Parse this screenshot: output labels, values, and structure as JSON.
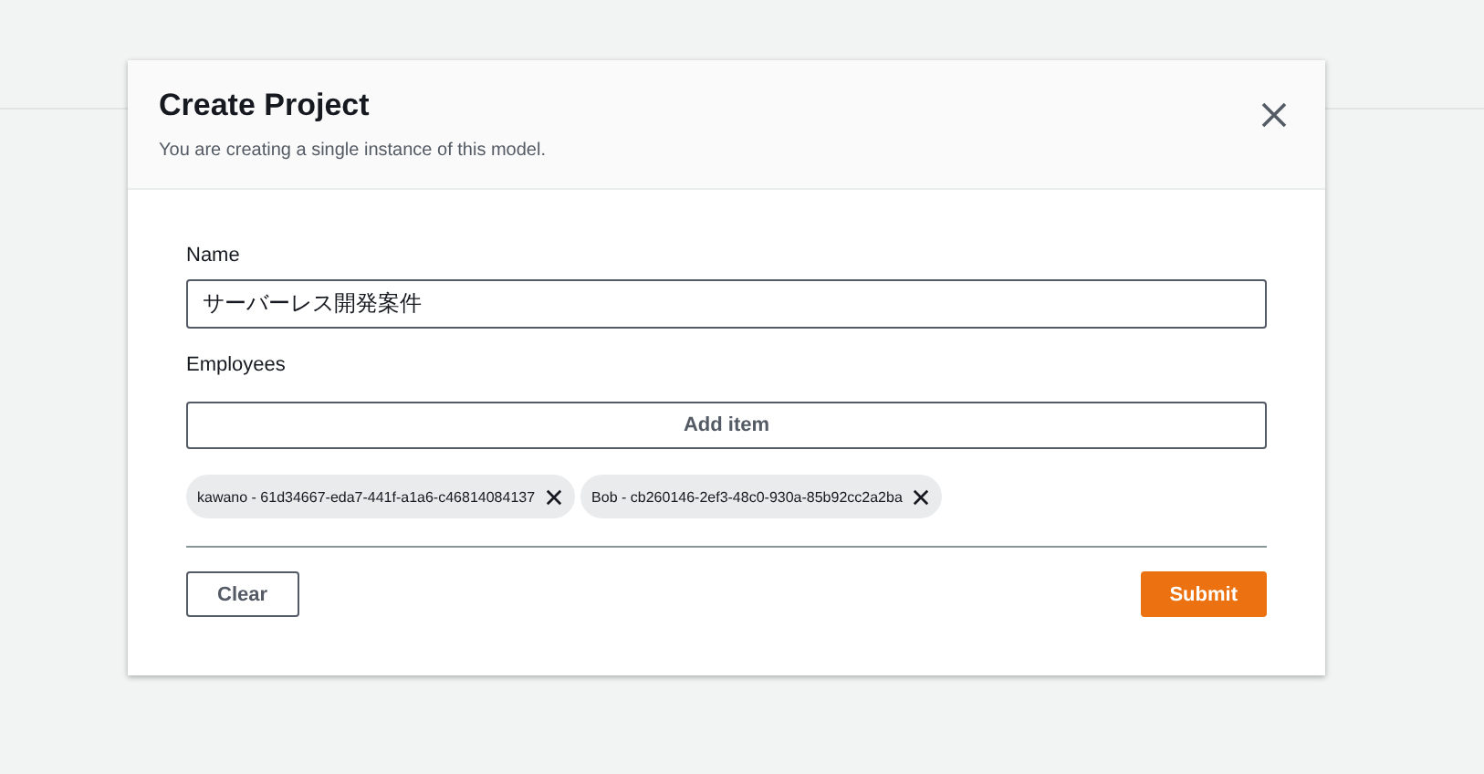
{
  "modal": {
    "title": "Create Project",
    "subtitle": "You are creating a single instance of this model."
  },
  "name_field": {
    "label": "Name",
    "value": "サーバーレス開発案件"
  },
  "employees": {
    "label": "Employees",
    "add_button": "Add item",
    "tokens": [
      {
        "label": "kawano - 61d34667-eda7-441f-a1a6-c46814084137"
      },
      {
        "label": "Bob - cb260146-2ef3-48c0-930a-85b92cc2a2ba"
      }
    ]
  },
  "buttons": {
    "clear": "Clear",
    "submit": "Submit"
  }
}
